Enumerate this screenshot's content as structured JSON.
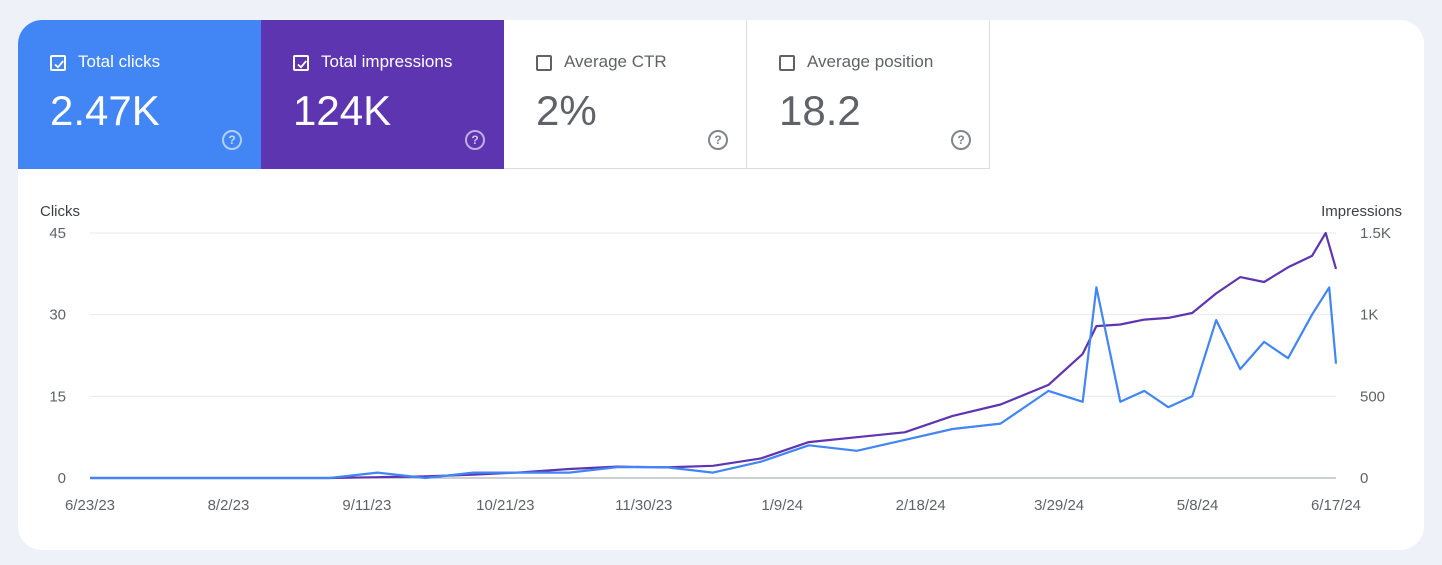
{
  "metrics": [
    {
      "label": "Total clicks",
      "value": "2.47K",
      "checked": true,
      "color": "#4285f4"
    },
    {
      "label": "Total impressions",
      "value": "124K",
      "checked": true,
      "color": "#5e35b1"
    },
    {
      "label": "Average CTR",
      "value": "2%",
      "checked": false,
      "color": "#ffffff"
    },
    {
      "label": "Average position",
      "value": "18.2",
      "checked": false,
      "color": "#ffffff"
    }
  ],
  "help_glyph": "?",
  "chart_data": {
    "type": "line",
    "ylabel_left": "Clicks",
    "ylabel_right": "Impressions",
    "y_left_ticks": [
      "0",
      "15",
      "30",
      "45"
    ],
    "y_right_ticks": [
      "0",
      "500",
      "1K",
      "1.5K"
    ],
    "y_left_range": [
      0,
      45
    ],
    "y_right_range": [
      0,
      1500
    ],
    "x_ticks": [
      "6/23/23",
      "8/2/23",
      "9/11/23",
      "10/21/23",
      "11/30/23",
      "1/9/24",
      "2/18/24",
      "3/29/24",
      "5/8/24",
      "6/17/24"
    ],
    "x_range": [
      "2023-06-23",
      "2024-06-21"
    ],
    "grid": true,
    "series": [
      {
        "name": "Total clicks",
        "axis": "left",
        "color": "#4285f4",
        "x": [
          "2023-06-23",
          "2023-07-07",
          "2023-07-21",
          "2023-08-04",
          "2023-08-18",
          "2023-09-01",
          "2023-09-15",
          "2023-09-29",
          "2023-10-13",
          "2023-10-27",
          "2023-11-10",
          "2023-11-24",
          "2023-12-08",
          "2023-12-22",
          "2024-01-05",
          "2024-01-19",
          "2024-02-02",
          "2024-02-16",
          "2024-03-01",
          "2024-03-15",
          "2024-03-29",
          "2024-04-08",
          "2024-04-12",
          "2024-04-19",
          "2024-04-26",
          "2024-05-03",
          "2024-05-10",
          "2024-05-17",
          "2024-05-24",
          "2024-05-31",
          "2024-06-07",
          "2024-06-14",
          "2024-06-19",
          "2024-06-21"
        ],
        "values": [
          0,
          0,
          0,
          0,
          0,
          0,
          1,
          0,
          1,
          1,
          1,
          2,
          2,
          1,
          3,
          6,
          5,
          7,
          9,
          10,
          16,
          14,
          35,
          14,
          16,
          13,
          15,
          29,
          20,
          25,
          22,
          30,
          35,
          21
        ]
      },
      {
        "name": "Total impressions",
        "axis": "right",
        "color": "#5e35b1",
        "x": [
          "2023-06-23",
          "2023-07-07",
          "2023-07-21",
          "2023-08-04",
          "2023-08-18",
          "2023-09-01",
          "2023-09-15",
          "2023-09-29",
          "2023-10-13",
          "2023-10-27",
          "2023-11-10",
          "2023-11-24",
          "2023-12-08",
          "2023-12-22",
          "2024-01-05",
          "2024-01-19",
          "2024-02-02",
          "2024-02-16",
          "2024-03-01",
          "2024-03-15",
          "2024-03-29",
          "2024-04-08",
          "2024-04-12",
          "2024-04-19",
          "2024-04-26",
          "2024-05-03",
          "2024-05-10",
          "2024-05-17",
          "2024-05-24",
          "2024-05-31",
          "2024-06-07",
          "2024-06-14",
          "2024-06-18",
          "2024-06-21"
        ],
        "values": [
          0,
          0,
          0,
          0,
          0,
          0,
          5,
          10,
          20,
          35,
          55,
          70,
          65,
          75,
          120,
          220,
          250,
          280,
          380,
          450,
          570,
          760,
          930,
          940,
          970,
          980,
          1010,
          1130,
          1230,
          1200,
          1290,
          1360,
          1500,
          1280
        ]
      }
    ]
  }
}
